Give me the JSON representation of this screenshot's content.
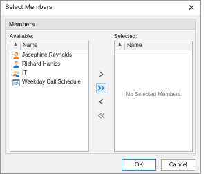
{
  "window": {
    "title": "Select Members",
    "close_glyph": "✕"
  },
  "group": {
    "title": "Members"
  },
  "available": {
    "label": "Available:",
    "column": "Name",
    "items": [
      {
        "name": "Josephine Reynolds",
        "icon": "female-user-icon"
      },
      {
        "name": "Richard Harriss",
        "icon": "male-user-icon"
      },
      {
        "name": "IT",
        "icon": "group-icon"
      },
      {
        "name": "Weekday Call Schedule",
        "icon": "calendar-icon"
      }
    ]
  },
  "selected": {
    "label": "Selected:",
    "column": "Name",
    "empty_text": "No Selected Members"
  },
  "buttons": {
    "ok": "OK",
    "cancel": "Cancel"
  },
  "colors": {
    "accent": "#2a7fd4",
    "disabled": "#8a8a8a"
  }
}
